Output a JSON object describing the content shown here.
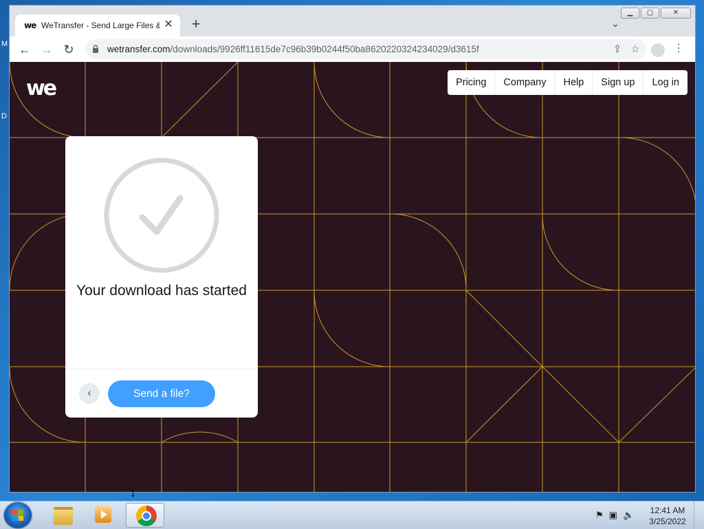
{
  "desktop": {
    "edge_letters": [
      "M",
      "D"
    ]
  },
  "browser": {
    "tab": {
      "favicon": "we",
      "title": "WeTransfer - Send Large Files &",
      "close_glyph": "✕"
    },
    "new_tab_glyph": "+",
    "tab_search_glyph": "⌄",
    "window_controls": {
      "minimize": "▁",
      "maximize": "▢",
      "close": "✕"
    },
    "nav": {
      "back": "←",
      "forward": "→",
      "reload": "↻"
    },
    "url": {
      "host": "wetransfer.com",
      "path": "/downloads/9926ff11615de7c96b39b0244f50ba8620220324234029/d3615f"
    },
    "share_glyph": "⇪",
    "star_glyph": "☆",
    "menu_glyph": "⋮"
  },
  "page": {
    "logo": "we",
    "nav": [
      "Pricing",
      "Company",
      "Help",
      "Sign up",
      "Log in"
    ],
    "card": {
      "message": "Your download has started",
      "back_glyph": "‹",
      "send_label": "Send a file?"
    },
    "colors": {
      "background": "#2a151f",
      "pattern_line": "#c89a2e",
      "button": "#409fff"
    }
  },
  "taskbar": {
    "clock_time": "12:41 AM",
    "clock_date": "3/25/2022",
    "tray_icons": [
      "flag-error-icon",
      "network-icon",
      "volume-icon"
    ]
  }
}
